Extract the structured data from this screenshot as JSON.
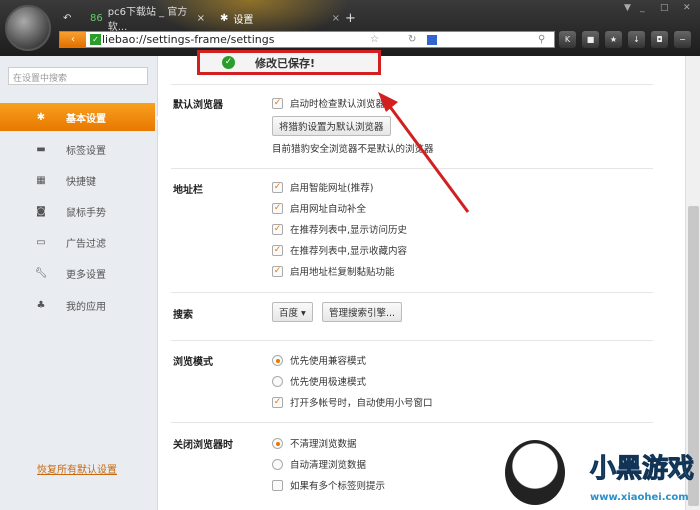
{
  "browser": {
    "tabs": [
      {
        "label": "pc6下载站 _ 官方软..."
      },
      {
        "label": "设置"
      }
    ],
    "url": "liebao://settings-frame/settings",
    "toolbar_icons": [
      "star-icon",
      "reader-icon",
      "refresh-icon",
      "search-engine-icon",
      "search-icon",
      "k-icon",
      "lock-icon",
      "favorites-icon",
      "download-icon",
      "game-icon",
      "menu-icon"
    ]
  },
  "toast": {
    "text": "修改已保存!"
  },
  "sidebar": {
    "search_placeholder": "在设置中搜索",
    "items": [
      {
        "label": "基本设置",
        "icon": "gear-icon"
      },
      {
        "label": "标签设置",
        "icon": "tab-icon"
      },
      {
        "label": "快捷键",
        "icon": "keyboard-icon"
      },
      {
        "label": "鼠标手势",
        "icon": "mouse-icon"
      },
      {
        "label": "广告过滤",
        "icon": "window-icon"
      },
      {
        "label": "更多设置",
        "icon": "wrench-icon"
      },
      {
        "label": "我的应用",
        "icon": "puzzle-icon"
      }
    ],
    "restore": "恢复所有默认设置"
  },
  "sections": {
    "default_browser": {
      "label": "默认浏览器",
      "check": "启动时检查默认浏览器",
      "button": "将猎豹设置为默认浏览器",
      "note": "目前猎豹安全浏览器不是默认的浏览器"
    },
    "address_bar": {
      "label": "地址栏",
      "options": [
        "启用智能网址(推荐)",
        "启用网址自动补全",
        "在推荐列表中,显示访问历史",
        "在推荐列表中,显示收藏内容",
        "启用地址栏复制黏贴功能"
      ]
    },
    "search": {
      "label": "搜索",
      "engine": "百度",
      "manage": "管理搜索引擎..."
    },
    "browse_mode": {
      "label": "浏览模式",
      "options": [
        "优先使用兼容模式",
        "优先使用极速模式"
      ],
      "check": "打开多帐号时，自动使用小号窗口"
    },
    "close": {
      "label": "关闭浏览器时",
      "options": [
        "不清理浏览数据",
        "自动清理浏览数据"
      ],
      "check": "如果有多个标签则提示"
    }
  },
  "watermark": {
    "text": "小黑游戏",
    "url": "www.xiaohei.com"
  }
}
